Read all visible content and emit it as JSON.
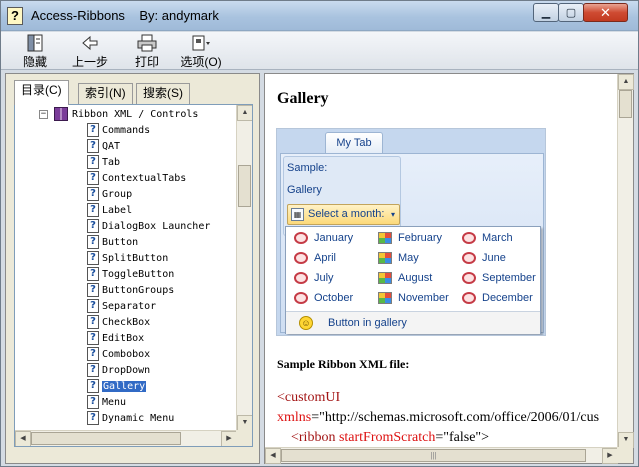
{
  "window": {
    "title": "Access-Ribbons    By: andymark",
    "app_icon": "?"
  },
  "toolbar": {
    "hide_label": "隐藏",
    "back_label": "上一步",
    "print_label": "打印",
    "options_label": "选项(O)"
  },
  "nav_tabs": [
    "目录(C)",
    "索引(N)",
    "搜索(S)"
  ],
  "tree": {
    "root": "Ribbon XML / Controls",
    "items": [
      "Commands",
      "QAT",
      "Tab",
      "ContextualTabs",
      "Group",
      "Label",
      "DialogBox Launcher",
      "Button",
      "SplitButton",
      "ToggleButton",
      "ButtonGroups",
      "Separator",
      "CheckBox",
      "EditBox",
      "Combobox",
      "DropDown",
      "Gallery",
      "Menu",
      "Dynamic Menu"
    ],
    "selected": "Gallery"
  },
  "content": {
    "heading": "Gallery",
    "ribbon": {
      "tab": "My Tab",
      "sample_label": "Sample:",
      "gallery_label": "Gallery",
      "dropdown_label": "Select a month:",
      "months": [
        "January",
        "February",
        "March",
        "April",
        "May",
        "June",
        "July",
        "August",
        "September",
        "October",
        "November",
        "December"
      ],
      "gallery_button": "Button in gallery"
    },
    "xml_heading": "Sample Ribbon XML file:",
    "code": {
      "line1_tag": "<customUI",
      "line2_attr": "xmlns",
      "line2_value": "=\"http://schemas.microsoft.com/office/2006/01/cus",
      "line3_tag": "<ribbon",
      "line3_attr": "startFromScratch",
      "line3_value": "=\"false\">"
    }
  },
  "colors": {
    "selection": "#316ac5",
    "ribbon_text": "#15428b",
    "xml_tag": "#a31515"
  }
}
